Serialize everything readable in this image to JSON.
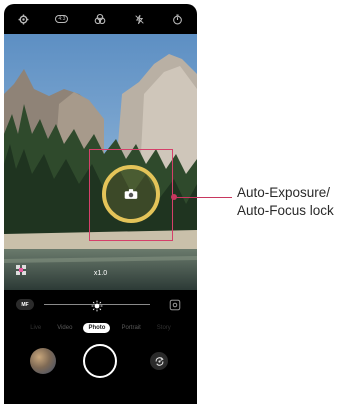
{
  "status_icons": [
    "settings-icon",
    "timer-4s-icon",
    "filter-icon",
    "flash-off-icon",
    "timer-icon"
  ],
  "timer_badge": "4:3",
  "viewfinder": {
    "zoom": "x1.0",
    "lock_icon": "camera-icon"
  },
  "controls": {
    "manual_focus": "MF",
    "modes": [
      "Live",
      "Video",
      "Photo",
      "Portrait",
      "Story"
    ],
    "active_mode": "Photo"
  },
  "callout": {
    "line1": "Auto-Exposure/",
    "line2": "Auto-Focus lock"
  },
  "colors": {
    "annotation": "#c8375f",
    "focus_ring": "#e4c459"
  }
}
